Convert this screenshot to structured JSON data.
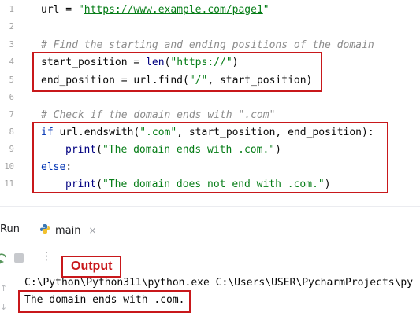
{
  "editor": {
    "line_numbers": [
      "1",
      "2",
      "3",
      "4",
      "5",
      "6",
      "7",
      "8",
      "9",
      "10",
      "11"
    ],
    "line1": {
      "var": "url = ",
      "q1": "\"",
      "url": "https://www.example.com/page1",
      "q2": "\""
    },
    "line3_comment": "# Find the starting and ending positions of the domain",
    "line4": {
      "a": "start_position = ",
      "fn": "len",
      "b": "(",
      "s": "\"https://\"",
      "c": ")"
    },
    "line5": {
      "a": "end_position = url.find(",
      "s": "\"/\"",
      "c": ", start_position)"
    },
    "line7_comment": "# Check if the domain ends with \".com\"",
    "line8": {
      "kw": "if",
      "a": " url.endswith(",
      "s": "\".com\"",
      "c": ", start_position, end_position):"
    },
    "line9": {
      "fn": "print",
      "a": "(",
      "s": "\"The domain ends with .com.\"",
      "c": ")"
    },
    "line10": {
      "kw": "else",
      "c": ":"
    },
    "line11": {
      "fn": "print",
      "a": "(",
      "s": "\"The domain does not end with .com.\"",
      "c": ")"
    }
  },
  "run_panel": {
    "title": "Run",
    "tab_label": "main",
    "tab_close": "×",
    "more": "⋮",
    "annotation_label": "Output",
    "command_line": "C:\\Python\\Python311\\python.exe C:\\Users\\USER\\PycharmProjects\\py",
    "output_line": "The domain ends with .com."
  },
  "colors": {
    "annotation_red": "#c8181b",
    "string_green": "#067d17",
    "keyword_blue": "#0033b3",
    "comment_gray": "#8c8c8c"
  }
}
